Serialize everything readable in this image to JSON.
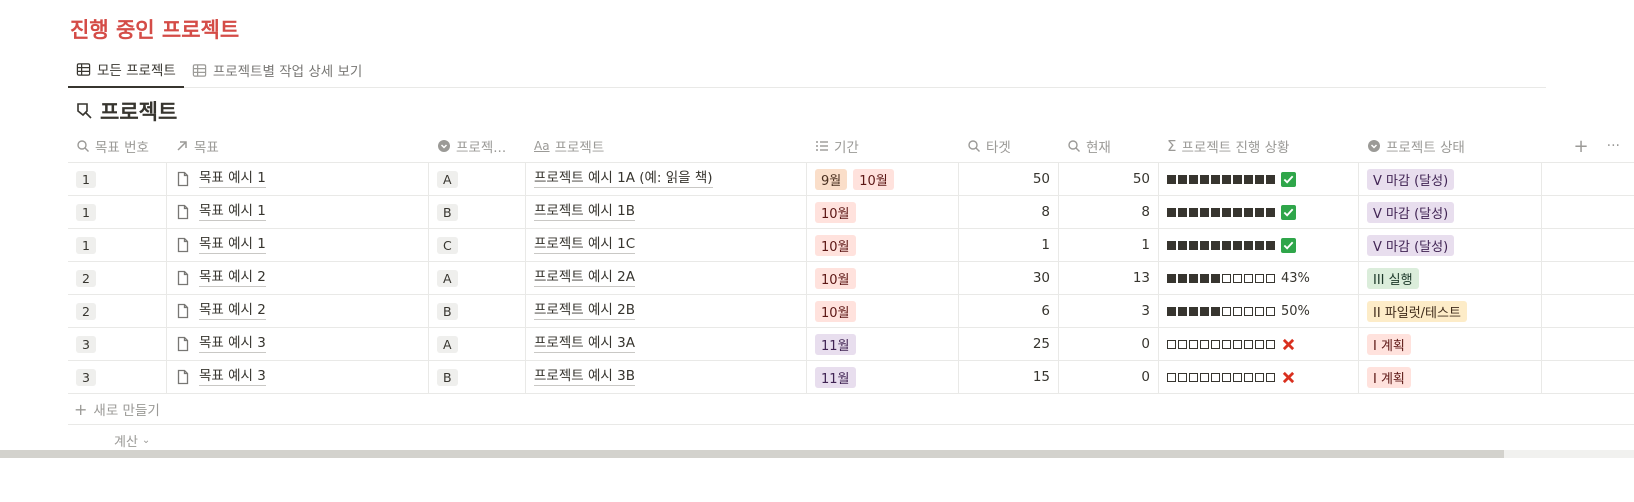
{
  "page_title": "진행 중인 프로젝트",
  "tabs": [
    {
      "label": "모든 프로젝트",
      "active": true
    },
    {
      "label": "프로젝트별 작업 상세 보기",
      "active": false
    }
  ],
  "database_title": "프로젝트",
  "columns": {
    "goal_no": "목표 번호",
    "goal": "목표",
    "project_code": "프로젝...",
    "project": "프로젝트",
    "period": "기간",
    "target": "타겟",
    "current": "현재",
    "progress": "프로젝트 진행 상황",
    "status": "프로젝트 상태"
  },
  "rows": [
    {
      "goal_no": "1",
      "goal": "목표 예시 1",
      "code": "A",
      "project": "프로젝트 예시 1A (예: 읽을 책)",
      "periods": [
        {
          "label": "9월",
          "color": "orange"
        },
        {
          "label": "10월",
          "color": "red"
        }
      ],
      "target": "50",
      "current": "50",
      "progress_blocks": 10,
      "progress_label": "✅",
      "progress_icon": "check",
      "status": "V 마감 (달성)",
      "status_color": "purple"
    },
    {
      "goal_no": "1",
      "goal": "목표 예시 1",
      "code": "B",
      "project": "프로젝트 예시 1B",
      "periods": [
        {
          "label": "10월",
          "color": "red"
        }
      ],
      "target": "8",
      "current": "8",
      "progress_blocks": 10,
      "progress_label": "✅",
      "progress_icon": "check",
      "status": "V 마감 (달성)",
      "status_color": "purple"
    },
    {
      "goal_no": "1",
      "goal": "목표 예시 1",
      "code": "C",
      "project": "프로젝트 예시 1C",
      "periods": [
        {
          "label": "10월",
          "color": "red"
        }
      ],
      "target": "1",
      "current": "1",
      "progress_blocks": 10,
      "progress_label": "✅",
      "progress_icon": "check",
      "status": "V 마감 (달성)",
      "status_color": "purple"
    },
    {
      "goal_no": "2",
      "goal": "목표 예시 2",
      "code": "A",
      "project": "프로젝트 예시 2A",
      "periods": [
        {
          "label": "10월",
          "color": "red"
        }
      ],
      "target": "30",
      "current": "13",
      "progress_blocks": 5,
      "progress_label": "43%",
      "progress_icon": "text",
      "status": "III 실행",
      "status_color": "green"
    },
    {
      "goal_no": "2",
      "goal": "목표 예시 2",
      "code": "B",
      "project": "프로젝트 예시 2B",
      "periods": [
        {
          "label": "10월",
          "color": "red"
        }
      ],
      "target": "6",
      "current": "3",
      "progress_blocks": 5,
      "progress_label": "50%",
      "progress_icon": "text",
      "status": "II 파일럿/테스트",
      "status_color": "yellow"
    },
    {
      "goal_no": "3",
      "goal": "목표 예시 3",
      "code": "A",
      "project": "프로젝트 예시 3A",
      "periods": [
        {
          "label": "11월",
          "color": "purple"
        }
      ],
      "target": "25",
      "current": "0",
      "progress_blocks": 0,
      "progress_label": "❌",
      "progress_icon": "cross",
      "status": "I 계획",
      "status_color": "red"
    },
    {
      "goal_no": "3",
      "goal": "목표 예시 3",
      "code": "B",
      "project": "프로젝트 예시 3B",
      "periods": [
        {
          "label": "11월",
          "color": "purple"
        }
      ],
      "target": "15",
      "current": "0",
      "progress_blocks": 0,
      "progress_label": "❌",
      "progress_icon": "cross",
      "status": "I 계획",
      "status_color": "red"
    }
  ],
  "new_row_label": "새로 만들기",
  "calc_label": "계산",
  "header_actions": {
    "add": "+",
    "more": "···"
  },
  "scroll_position": 0.0
}
